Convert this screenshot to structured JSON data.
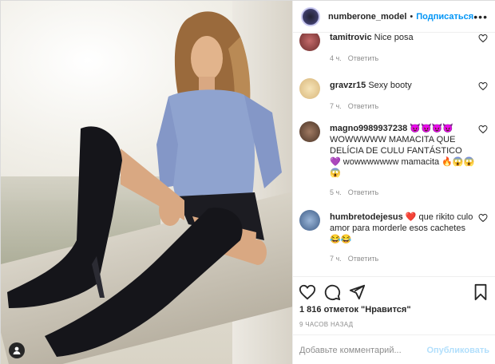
{
  "post": {
    "username": "numberone_model",
    "separator": "•",
    "follow_label": "Подписаться",
    "more_label": "•••"
  },
  "comments": [
    {
      "user": "tamitrovic",
      "text": "Nice posa",
      "time": "4 ч.",
      "reply": "Ответить"
    },
    {
      "user": "gravzr15",
      "text": "Sexy booty",
      "time": "7 ч.",
      "reply": "Ответить"
    },
    {
      "user": "magno9989937238",
      "text": "😈😈😈😈 WOWWWWW MAMACITA QUE DELÍCIA DE CULU FANTÁSTICO 💜 wowwwwwww mamacita 🔥😱😱😱",
      "time": "5 ч.",
      "reply": "Ответить"
    },
    {
      "user": "humbretodejesus",
      "text": "❤️ que rikito culo amor para morderle esos cachetes 😂😂",
      "time": "7 ч.",
      "reply": "Ответить"
    }
  ],
  "stats": {
    "likes": "1 816 отметок \"Нравится\"",
    "time": "9 ЧАСОВ НАЗАД"
  },
  "compose": {
    "placeholder": "Добавьте комментарий...",
    "post_label": "Опубликовать"
  },
  "icons": {
    "like": "heart-icon",
    "comment": "comment-icon",
    "share": "share-icon",
    "save": "bookmark-icon"
  },
  "colors": {
    "accent": "#0095f6",
    "post_disabled": "#b2dffc",
    "muted": "#8e8e8e"
  }
}
